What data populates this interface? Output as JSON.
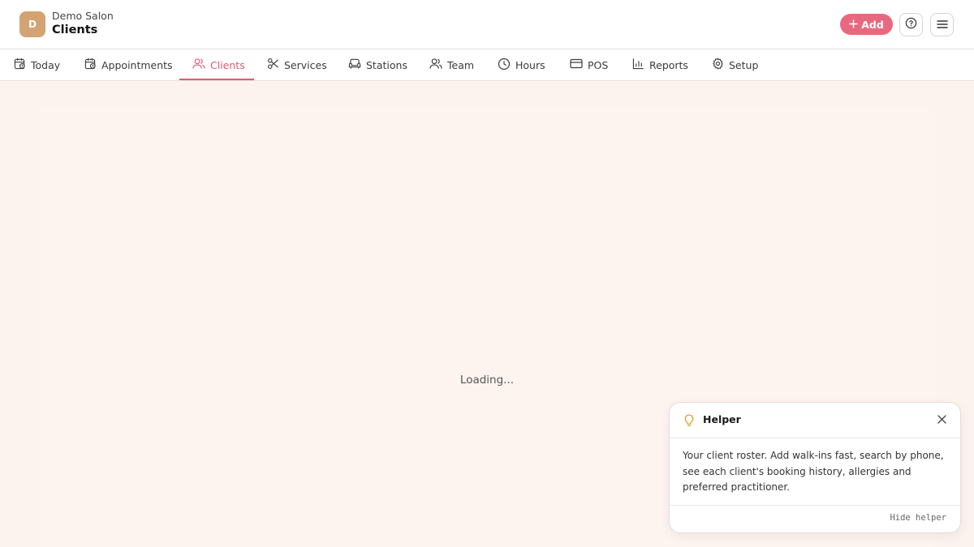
{
  "header": {
    "avatar_letter": "D",
    "salon_name": "Demo Salon",
    "page_title": "Clients",
    "add_label": "Add",
    "colors": {
      "accent": "#e8697f",
      "avatar": "#d4a373"
    }
  },
  "nav": {
    "tabs": [
      {
        "label": "Today",
        "icon": "calendar-today-icon"
      },
      {
        "label": "Appointments",
        "icon": "calendar-clock-icon"
      },
      {
        "label": "Clients",
        "icon": "users-icon",
        "active": true
      },
      {
        "label": "Services",
        "icon": "scissors-icon"
      },
      {
        "label": "Stations",
        "icon": "armchair-icon"
      },
      {
        "label": "Team",
        "icon": "team-icon"
      },
      {
        "label": "Hours",
        "icon": "clock-icon"
      },
      {
        "label": "POS",
        "icon": "credit-card-icon"
      },
      {
        "label": "Reports",
        "icon": "bar-chart-icon"
      },
      {
        "label": "Setup",
        "icon": "gear-icon"
      }
    ]
  },
  "main": {
    "loading_text": "Loading..."
  },
  "helper": {
    "title": "Helper",
    "body": "Your client roster. Add walk-ins fast, search by phone, see each client's booking history, allergies and preferred practitioner.",
    "hide_label": "Hide helper"
  }
}
